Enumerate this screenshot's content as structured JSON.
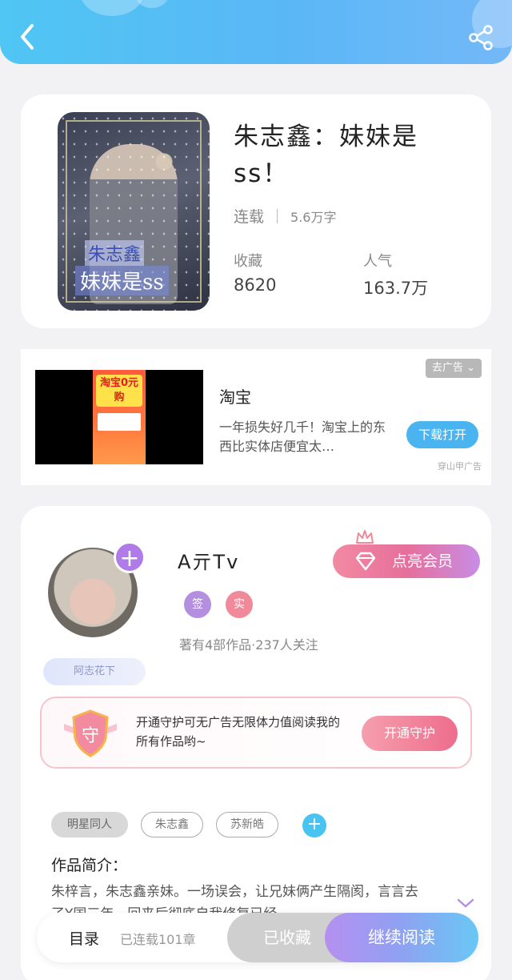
{
  "header": {
    "back_icon": "back-arrow-icon",
    "share_icon": "share-icon",
    "colors": {
      "gradient_start": "#4fc6f3",
      "gradient_end": "#73b8f8"
    }
  },
  "book": {
    "title": "朱志鑫：妹妹是ss！",
    "cover_text_line1": "朱志鑫",
    "cover_text_line2": "妹妹是ss",
    "status": "连载",
    "words": "5.6万字",
    "favorites_label": "收藏",
    "favorites_value": "8620",
    "popularity_label": "人气",
    "popularity_value": "163.7万"
  },
  "ad": {
    "close_label": "去广告",
    "image_text": "淘宝0元购",
    "title": "淘宝",
    "description": "一年损失好几千！淘宝上的东西比实体店便宜太…",
    "button_label": "下载打开",
    "source": "穿山甲广告"
  },
  "author": {
    "name": "A亓Tv",
    "badge_1": "签",
    "badge_2": "实",
    "stats": "著有4部作品·237人关注",
    "fans_tag": "阿志花下",
    "vip_label": "点亮会员",
    "guard_shield_char": "守",
    "guard_text": "开通守护可无广告无限体力值阅读我的所有作品哟~",
    "guard_button": "开通守护",
    "colors": {
      "badge_1": "#b48fe0",
      "badge_2": "#f08a9a",
      "vip": "#e66f9b"
    }
  },
  "tags": [
    "明星同人",
    "朱志鑫",
    "苏新皓"
  ],
  "intro": {
    "title": "作品简介：",
    "text": "朱梓言，朱志鑫亲妹。一场误会，让兄妹俩产生隔阂，言言去了Y国三年，回来后彻底自我修复已经…"
  },
  "bottom_bar": {
    "toc_label": "目录",
    "toc_status": "已连载101章",
    "fav_label": "已收藏",
    "read_label": "继续阅读"
  }
}
